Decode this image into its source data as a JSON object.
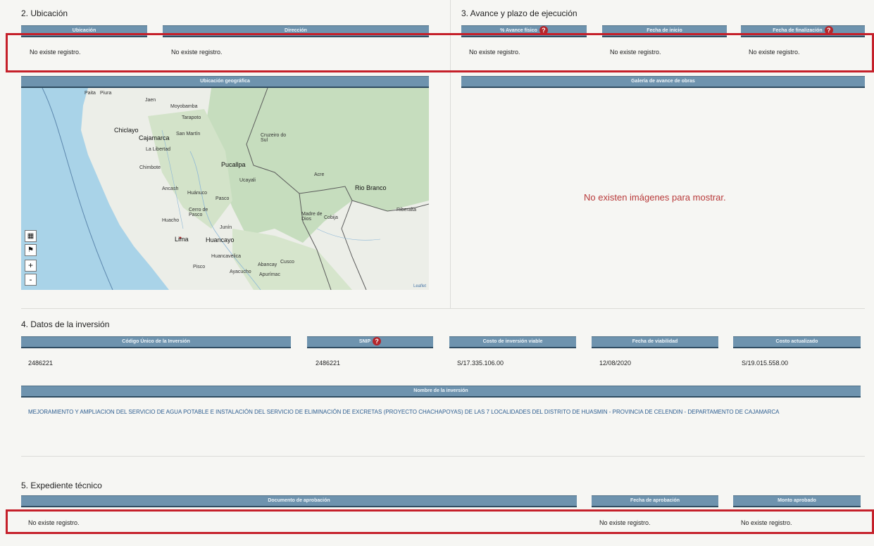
{
  "sec2": {
    "title": "2. Ubicación",
    "h_ubicacion": "Ubicación",
    "h_direccion": "Dirección",
    "v_ubicacion": "No existe registro.",
    "v_direccion": "No existe registro.",
    "h_mapa": "Ubicación geográfica",
    "map": {
      "attribution": "Leaflet",
      "labels": [
        "Paita",
        "Piura",
        "Jaen",
        "Moyobamba",
        "Tarapoto",
        "Chiclayo",
        "Cajamarca",
        "La Libertad",
        "Chimbote",
        "Pucallpa",
        "Cruzeiro do Sul",
        "Acre",
        "Rio Branco",
        "Huánuco",
        "Pasco",
        "Cerro de Pasco",
        "Huacho",
        "Lima",
        "Huancayo",
        "Junín",
        "Ucayali",
        "Madre de Dios",
        "Cobija",
        "Riberalta",
        "Pisco",
        "Abancay",
        "Cusco",
        "Apurímac",
        "Ayacucho",
        "Huancavelica",
        "Ancash",
        "San Martín"
      ],
      "controls": {
        "zoom_in": "+",
        "zoom_out": "-"
      }
    }
  },
  "sec3": {
    "title": "3. Avance y plazo de ejecución",
    "h_avance": "% Avance físico",
    "h_inicio": "Fecha de inicio",
    "h_fin": "Fecha de finalización",
    "v_avance": "No existe registro.",
    "v_inicio": "No existe registro.",
    "v_fin": "No existe registro.",
    "h_galeria": "Galería de avance de obras",
    "no_images": "No existen imágenes para mostrar."
  },
  "sec4": {
    "title": "4. Datos de la inversión",
    "h_codigo": "Código Único de la Inversión",
    "h_snip": "SNIP",
    "h_costo": "Costo de inversión viable",
    "h_fecha": "Fecha de viabilidad",
    "h_actualizado": "Costo actualizado",
    "v_codigo": "2486221",
    "v_snip": "2486221",
    "v_costo": "S/17.335.106.00",
    "v_fecha": "12/08/2020",
    "v_actualizado": "S/19.015.558.00",
    "h_nombre": "Nombre de la inversión",
    "v_nombre": "MEJORAMIENTO Y AMPLIACION DEL SERVICIO DE AGUA POTABLE E INSTALACIÓN DEL SERVICIO DE ELIMINACIÓN DE EXCRETAS (PROYECTO CHACHAPOYAS) DE LAS 7 LOCALIDADES DEL DISTRITO DE HUASMIN - PROVINCIA DE CELENDIN - DEPARTAMENTO DE CAJAMARCA"
  },
  "sec5": {
    "title": "5. Expediente técnico",
    "h_doc": "Documento de aprobación",
    "h_fecha": "Fecha de aprobación",
    "h_monto": "Monto aprobado",
    "v_doc": "No existe registro.",
    "v_fecha": "No existe registro.",
    "v_monto": "No existe registro."
  },
  "colors": {
    "header_bg": "#6e93ae",
    "highlight_border": "#c5202a",
    "help_badge": "#b4262b",
    "message_text": "#b83a3a",
    "link_text": "#2b5c8f"
  }
}
